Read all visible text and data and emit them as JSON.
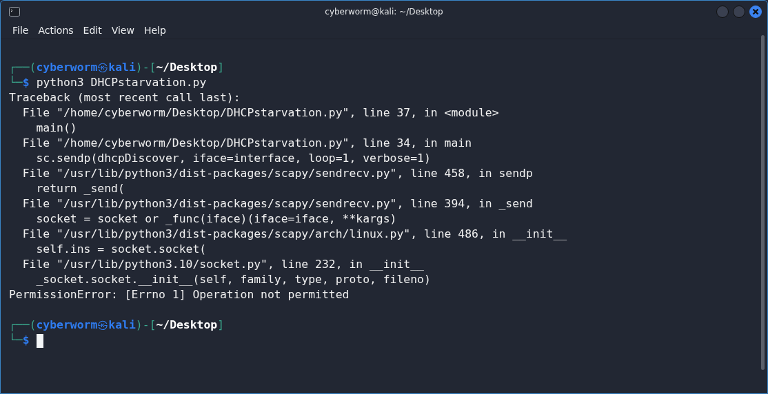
{
  "window": {
    "title": "cyberworm@kali: ~/Desktop"
  },
  "menu": [
    {
      "label": "File"
    },
    {
      "label": "Actions"
    },
    {
      "label": "Edit"
    },
    {
      "label": "View"
    },
    {
      "label": "Help"
    }
  ],
  "terminal": {
    "lines": [
      {
        "kind": "blank"
      },
      {
        "kind": "prompt_top",
        "open": "┌──(",
        "user": "cyberworm",
        "at": "㉿",
        "host": "kali",
        "mid": ")-[",
        "path": "~/Desktop",
        "close": "]"
      },
      {
        "kind": "prompt_cmd",
        "corner": "└─",
        "symbol": "$",
        "command": "python3 DHCPstarvation.py"
      },
      {
        "kind": "output",
        "text": "Traceback (most recent call last):"
      },
      {
        "kind": "output",
        "text": "  File \"/home/cyberworm/Desktop/DHCPstarvation.py\", line 37, in <module>"
      },
      {
        "kind": "output",
        "text": "    main()"
      },
      {
        "kind": "output",
        "text": "  File \"/home/cyberworm/Desktop/DHCPstarvation.py\", line 34, in main"
      },
      {
        "kind": "output",
        "text": "    sc.sendp(dhcpDiscover, iface=interface, loop=1, verbose=1)"
      },
      {
        "kind": "output",
        "text": "  File \"/usr/lib/python3/dist-packages/scapy/sendrecv.py\", line 458, in sendp"
      },
      {
        "kind": "output",
        "text": "    return _send("
      },
      {
        "kind": "output",
        "text": "  File \"/usr/lib/python3/dist-packages/scapy/sendrecv.py\", line 394, in _send"
      },
      {
        "kind": "output",
        "text": "    socket = socket or _func(iface)(iface=iface, **kargs)"
      },
      {
        "kind": "output",
        "text": "  File \"/usr/lib/python3/dist-packages/scapy/arch/linux.py\", line 486, in __init__"
      },
      {
        "kind": "output",
        "text": "    self.ins = socket.socket("
      },
      {
        "kind": "output",
        "text": "  File \"/usr/lib/python3.10/socket.py\", line 232, in __init__"
      },
      {
        "kind": "output",
        "text": "    _socket.socket.__init__(self, family, type, proto, fileno)"
      },
      {
        "kind": "output",
        "text": "PermissionError: [Errno 1] Operation not permitted"
      },
      {
        "kind": "blank"
      },
      {
        "kind": "prompt_top",
        "open": "┌──(",
        "user": "cyberworm",
        "at": "㉿",
        "host": "kali",
        "mid": ")-[",
        "path": "~/Desktop",
        "close": "]"
      },
      {
        "kind": "prompt_cmd",
        "corner": "└─",
        "symbol": "$",
        "cursor": true
      }
    ]
  }
}
